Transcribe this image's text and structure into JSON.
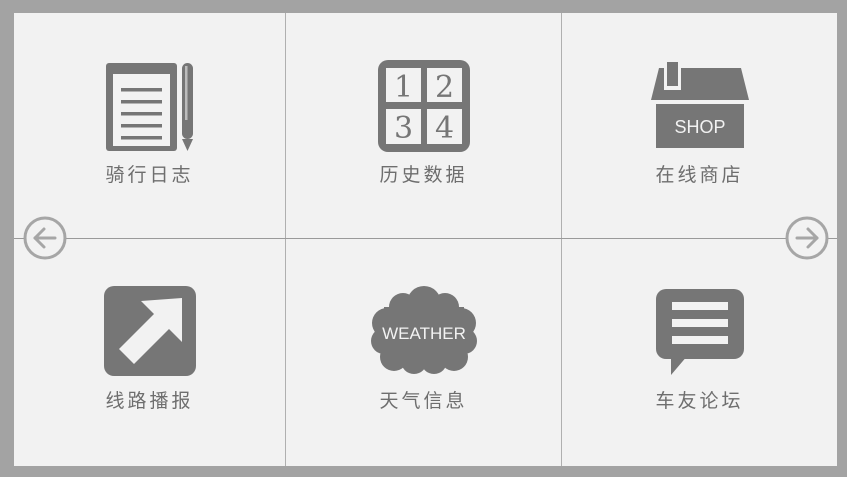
{
  "tiles": [
    {
      "label": "骑行日志",
      "icon": "notebook-pen-icon"
    },
    {
      "label": "历史数据",
      "icon": "numbers-grid-icon",
      "grid_numbers": [
        "1",
        "2",
        "3",
        "4"
      ]
    },
    {
      "label": "在线商店",
      "icon": "shop-icon",
      "sign_text": "SHOP"
    },
    {
      "label": "线路播报",
      "icon": "arrow-up-right-icon"
    },
    {
      "label": "天气信息",
      "icon": "weather-cloud-icon",
      "cloud_text": "WEATHER"
    },
    {
      "label": "车友论坛",
      "icon": "chat-bubble-icon"
    }
  ],
  "nav": {
    "prev_icon": "arrow-left-circle-icon",
    "next_icon": "arrow-right-circle-icon"
  },
  "colors": {
    "background": "#f2f2f2",
    "frame": "#a3a3a3",
    "icon": "#767676",
    "label": "#6e6e6e",
    "divider": "#9a9a9a"
  }
}
